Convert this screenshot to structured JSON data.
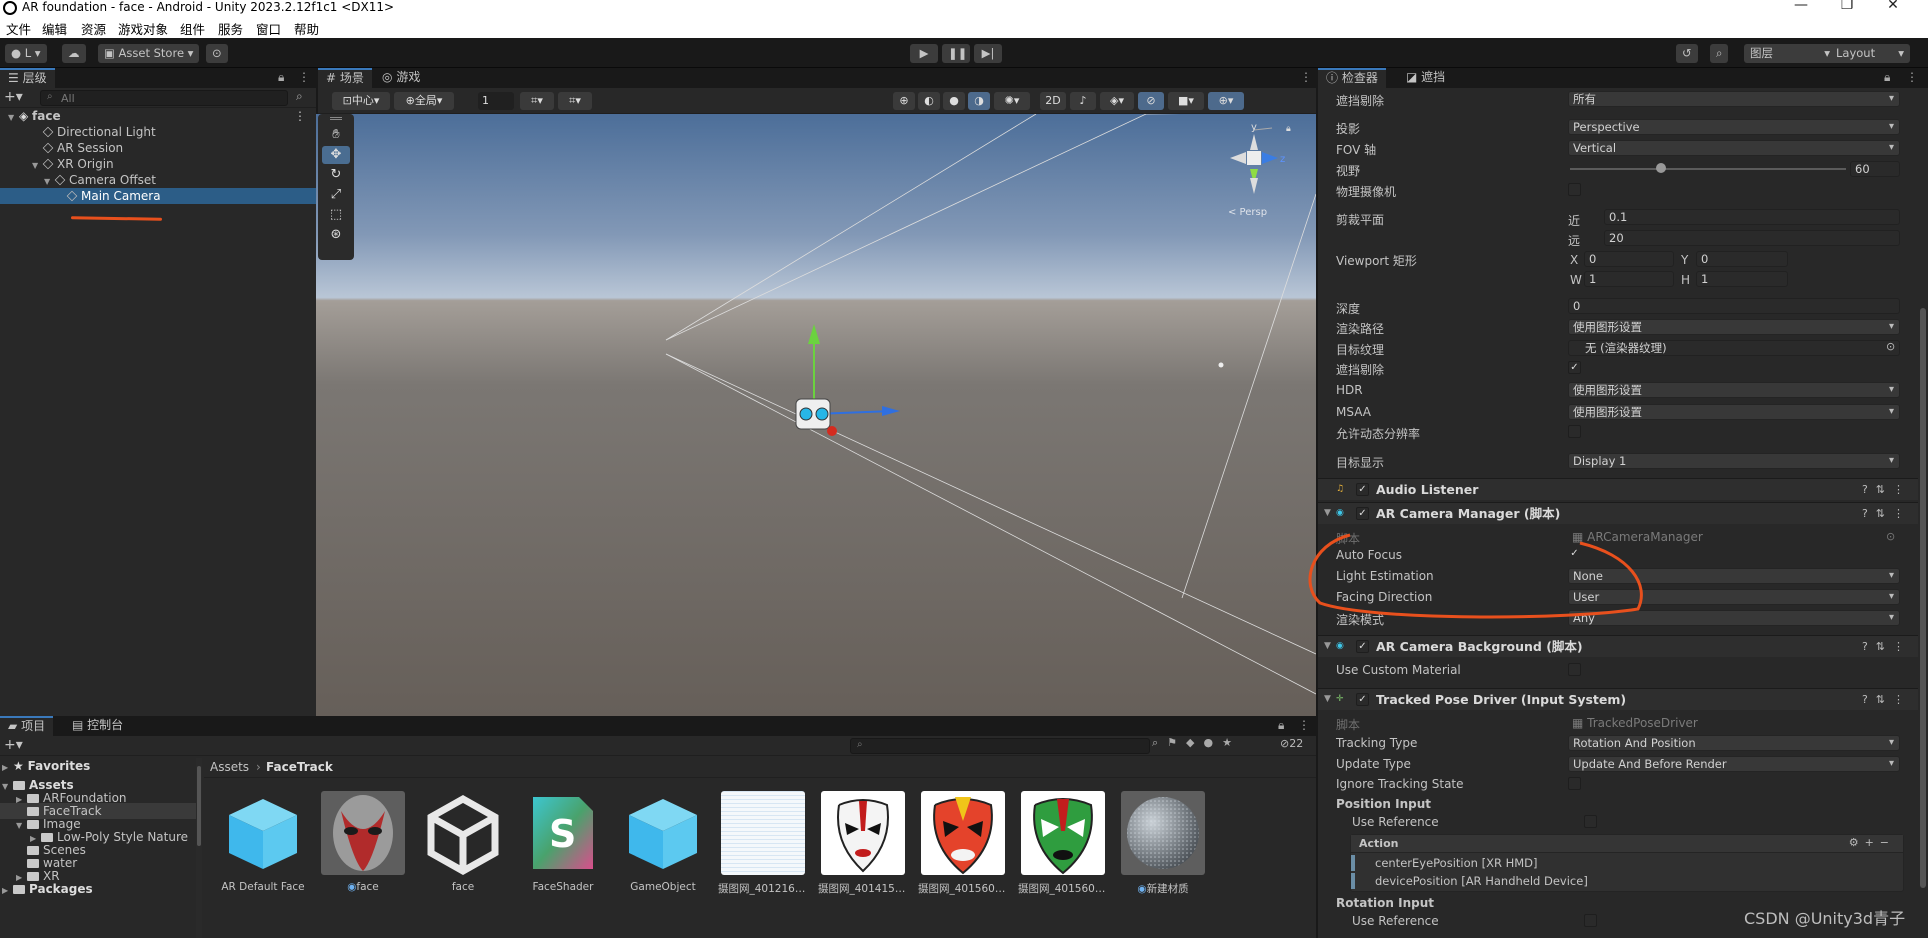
{
  "window": {
    "title": "AR foundation - face - Android - Unity 2023.2.12f1c1 <DX11>",
    "controls": [
      "—",
      "❐",
      "✕"
    ]
  },
  "menu": [
    "文件",
    "编辑",
    "资源",
    "游戏对象",
    "组件",
    "服务",
    "窗口",
    "帮助"
  ],
  "toolbar": {
    "account": "L",
    "asset_store": "Asset Store",
    "layers": "图层",
    "layout": "Layout"
  },
  "hierarchy": {
    "tab": "层级",
    "search_placeholder": "All",
    "items": [
      {
        "label": "face",
        "indent": 0,
        "type": "scene"
      },
      {
        "label": "Directional Light",
        "indent": 2
      },
      {
        "label": "AR Session",
        "indent": 2
      },
      {
        "label": "XR Origin",
        "indent": 2
      },
      {
        "label": "Camera Offset",
        "indent": 3
      },
      {
        "label": "Main Camera",
        "indent": 4,
        "selected": true
      }
    ]
  },
  "scene": {
    "tab_scene": "场景",
    "tab_game": "游戏",
    "pivot": "中心",
    "global": "全局",
    "grid_size": "1",
    "mode_2d": "2D",
    "persp_label": "< Persp"
  },
  "inspector": {
    "tab_inspector": "检查器",
    "tab_navigation": "遮挡",
    "camera": {
      "culling_label": "遮挡剔除",
      "culling": "所有",
      "projection_label": "投影",
      "projection": "Perspective",
      "fov_axis_label": "FOV 轴",
      "fov_axis": "Vertical",
      "fov_label": "视野",
      "fov": "60",
      "physical_label": "物理摄像机",
      "clip_label": "剪裁平面",
      "near_label": "近",
      "near": "0.1",
      "far_label": "远",
      "far": "20",
      "viewport_label": "Viewport 矩形",
      "vx": "0",
      "vy": "0",
      "vw": "1",
      "vh": "1",
      "depth_label": "深度",
      "depth": "0",
      "render_path_label": "渲染路径",
      "render_path": "使用图形设置",
      "target_tex_label": "目标纹理",
      "target_tex": "无 (渲染器纹理)",
      "occlusion_label": "遮挡剔除",
      "hdr_label": "HDR",
      "hdr": "使用图形设置",
      "msaa_label": "MSAA",
      "msaa": "使用图形设置",
      "dyn_res_label": "允许动态分辨率",
      "target_display_label": "目标显示",
      "target_display": "Display 1"
    },
    "audio_listener": "Audio Listener",
    "ar_cam_manager": {
      "title": "AR Camera Manager (脚本)",
      "script_label": "脚本",
      "script": "ARCameraManager",
      "auto_focus": "Auto Focus",
      "light_est_label": "Light Estimation",
      "light_est": "None",
      "facing_label": "Facing Direction",
      "facing": "User",
      "render_mode_label": "渲染模式",
      "render_mode": "Any"
    },
    "ar_cam_bg": {
      "title": "AR Camera Background (脚本)",
      "custom_mat": "Use Custom Material"
    },
    "tpd": {
      "title": "Tracked Pose Driver (Input System)",
      "script_label": "脚本",
      "script": "TrackedPoseDriver",
      "tracking_type_label": "Tracking Type",
      "tracking_type": "Rotation And Position",
      "update_type_label": "Update Type",
      "update_type": "Update And Before Render",
      "ignore_label": "Ignore Tracking State",
      "pos_input": "Position Input",
      "use_ref": "Use Reference",
      "action": "Action",
      "bind1": "centerEyePosition [XR HMD]",
      "bind2": "devicePosition [AR Handheld Device]",
      "rot_input": "Rotation Input",
      "use_ref2": "Use Reference"
    }
  },
  "project": {
    "tab_project": "项目",
    "tab_console": "控制台",
    "breadcrumb_root": "Assets",
    "breadcrumb_leaf": "FaceTrack",
    "hidden_count": "22",
    "tree": [
      {
        "label": "Favorites",
        "indent": 0,
        "bold": true,
        "star": true
      },
      {
        "label": "Assets",
        "indent": 0,
        "bold": true
      },
      {
        "label": "ARFoundation",
        "indent": 1
      },
      {
        "label": "FaceTrack",
        "indent": 1,
        "selected": true
      },
      {
        "label": "Image",
        "indent": 1
      },
      {
        "label": "Low-Poly Style Nature",
        "indent": 2
      },
      {
        "label": "Scenes",
        "indent": 1
      },
      {
        "label": "water",
        "indent": 1
      },
      {
        "label": "XR",
        "indent": 1
      },
      {
        "label": "Packages",
        "indent": 0,
        "bold": true
      }
    ],
    "assets": [
      "AR Default Face",
      "face",
      "face",
      "FaceShader",
      "GameObject",
      "摄图网_4012162...",
      "摄图网_4014155...",
      "摄图网_4015603...",
      "摄图网_4015604...",
      "新建材质"
    ]
  },
  "watermark": "CSDN @Unity3d青子",
  "colors": {
    "accent": "#3a79bb",
    "selection": "#2c5d87",
    "annotation": "#e8501d"
  }
}
